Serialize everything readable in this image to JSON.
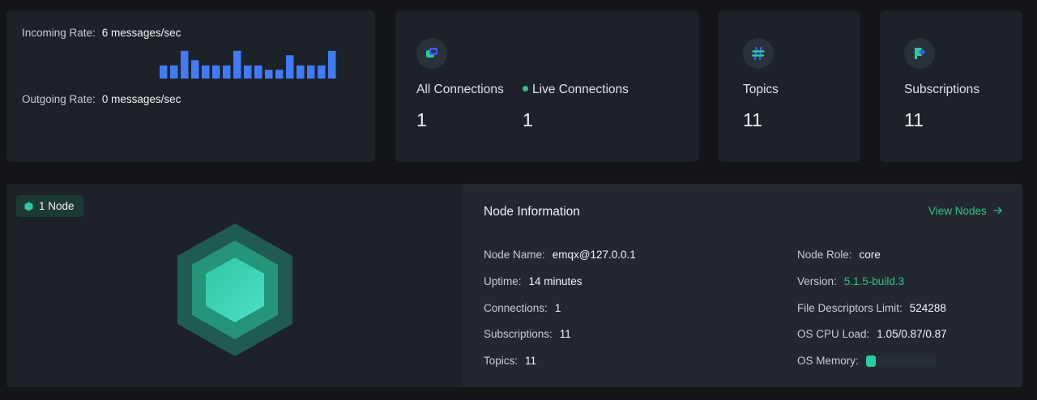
{
  "rates": {
    "incoming_label": "Incoming Rate:",
    "incoming_value": "6 messages/sec",
    "outgoing_label": "Outgoing Rate:",
    "outgoing_value": "0 messages/sec",
    "bar_color": "#3f7cf5",
    "bar_levels": [
      0.45,
      0.45,
      0.95,
      0.63,
      0.45,
      0.45,
      0.45,
      0.95,
      0.45,
      0.45,
      0.3,
      0.3,
      0.8,
      0.45,
      0.45,
      0.45,
      0.95
    ]
  },
  "stats": {
    "connections": {
      "icon": "connections-icon",
      "all_label": "All Connections",
      "all_value": "1",
      "live_label": "Live Connections",
      "live_value": "1"
    },
    "topics": {
      "icon": "hash-icon",
      "label": "Topics",
      "value": "11"
    },
    "subscriptions": {
      "icon": "subscription-icon",
      "label": "Subscriptions",
      "value": "11"
    }
  },
  "node": {
    "badge": "1 Node",
    "info_title": "Node Information",
    "view_nodes": "View Nodes",
    "left_rows": [
      {
        "key": "Node Name:",
        "value": "emqx@127.0.0.1"
      },
      {
        "key": "Uptime:",
        "value": "14 minutes"
      },
      {
        "key": "Connections:",
        "value": "1"
      },
      {
        "key": "Subscriptions:",
        "value": "11"
      },
      {
        "key": "Topics:",
        "value": "11"
      }
    ],
    "right_rows": [
      {
        "key": "Node Role:",
        "value": "core"
      },
      {
        "key": "Version:",
        "value": "5.1.5-build.3"
      },
      {
        "key": "File Descriptors Limit:",
        "value": "524288"
      },
      {
        "key": "OS CPU Load:",
        "value": "1.05/0.87/0.87"
      },
      {
        "key": "OS Memory:"
      }
    ],
    "os_memory_fraction": 0.14
  },
  "colors": {
    "accent_green": "#2fc285",
    "teal": "#2bc9a6",
    "card_bg": "#1d2128",
    "page_bg": "#131519"
  }
}
